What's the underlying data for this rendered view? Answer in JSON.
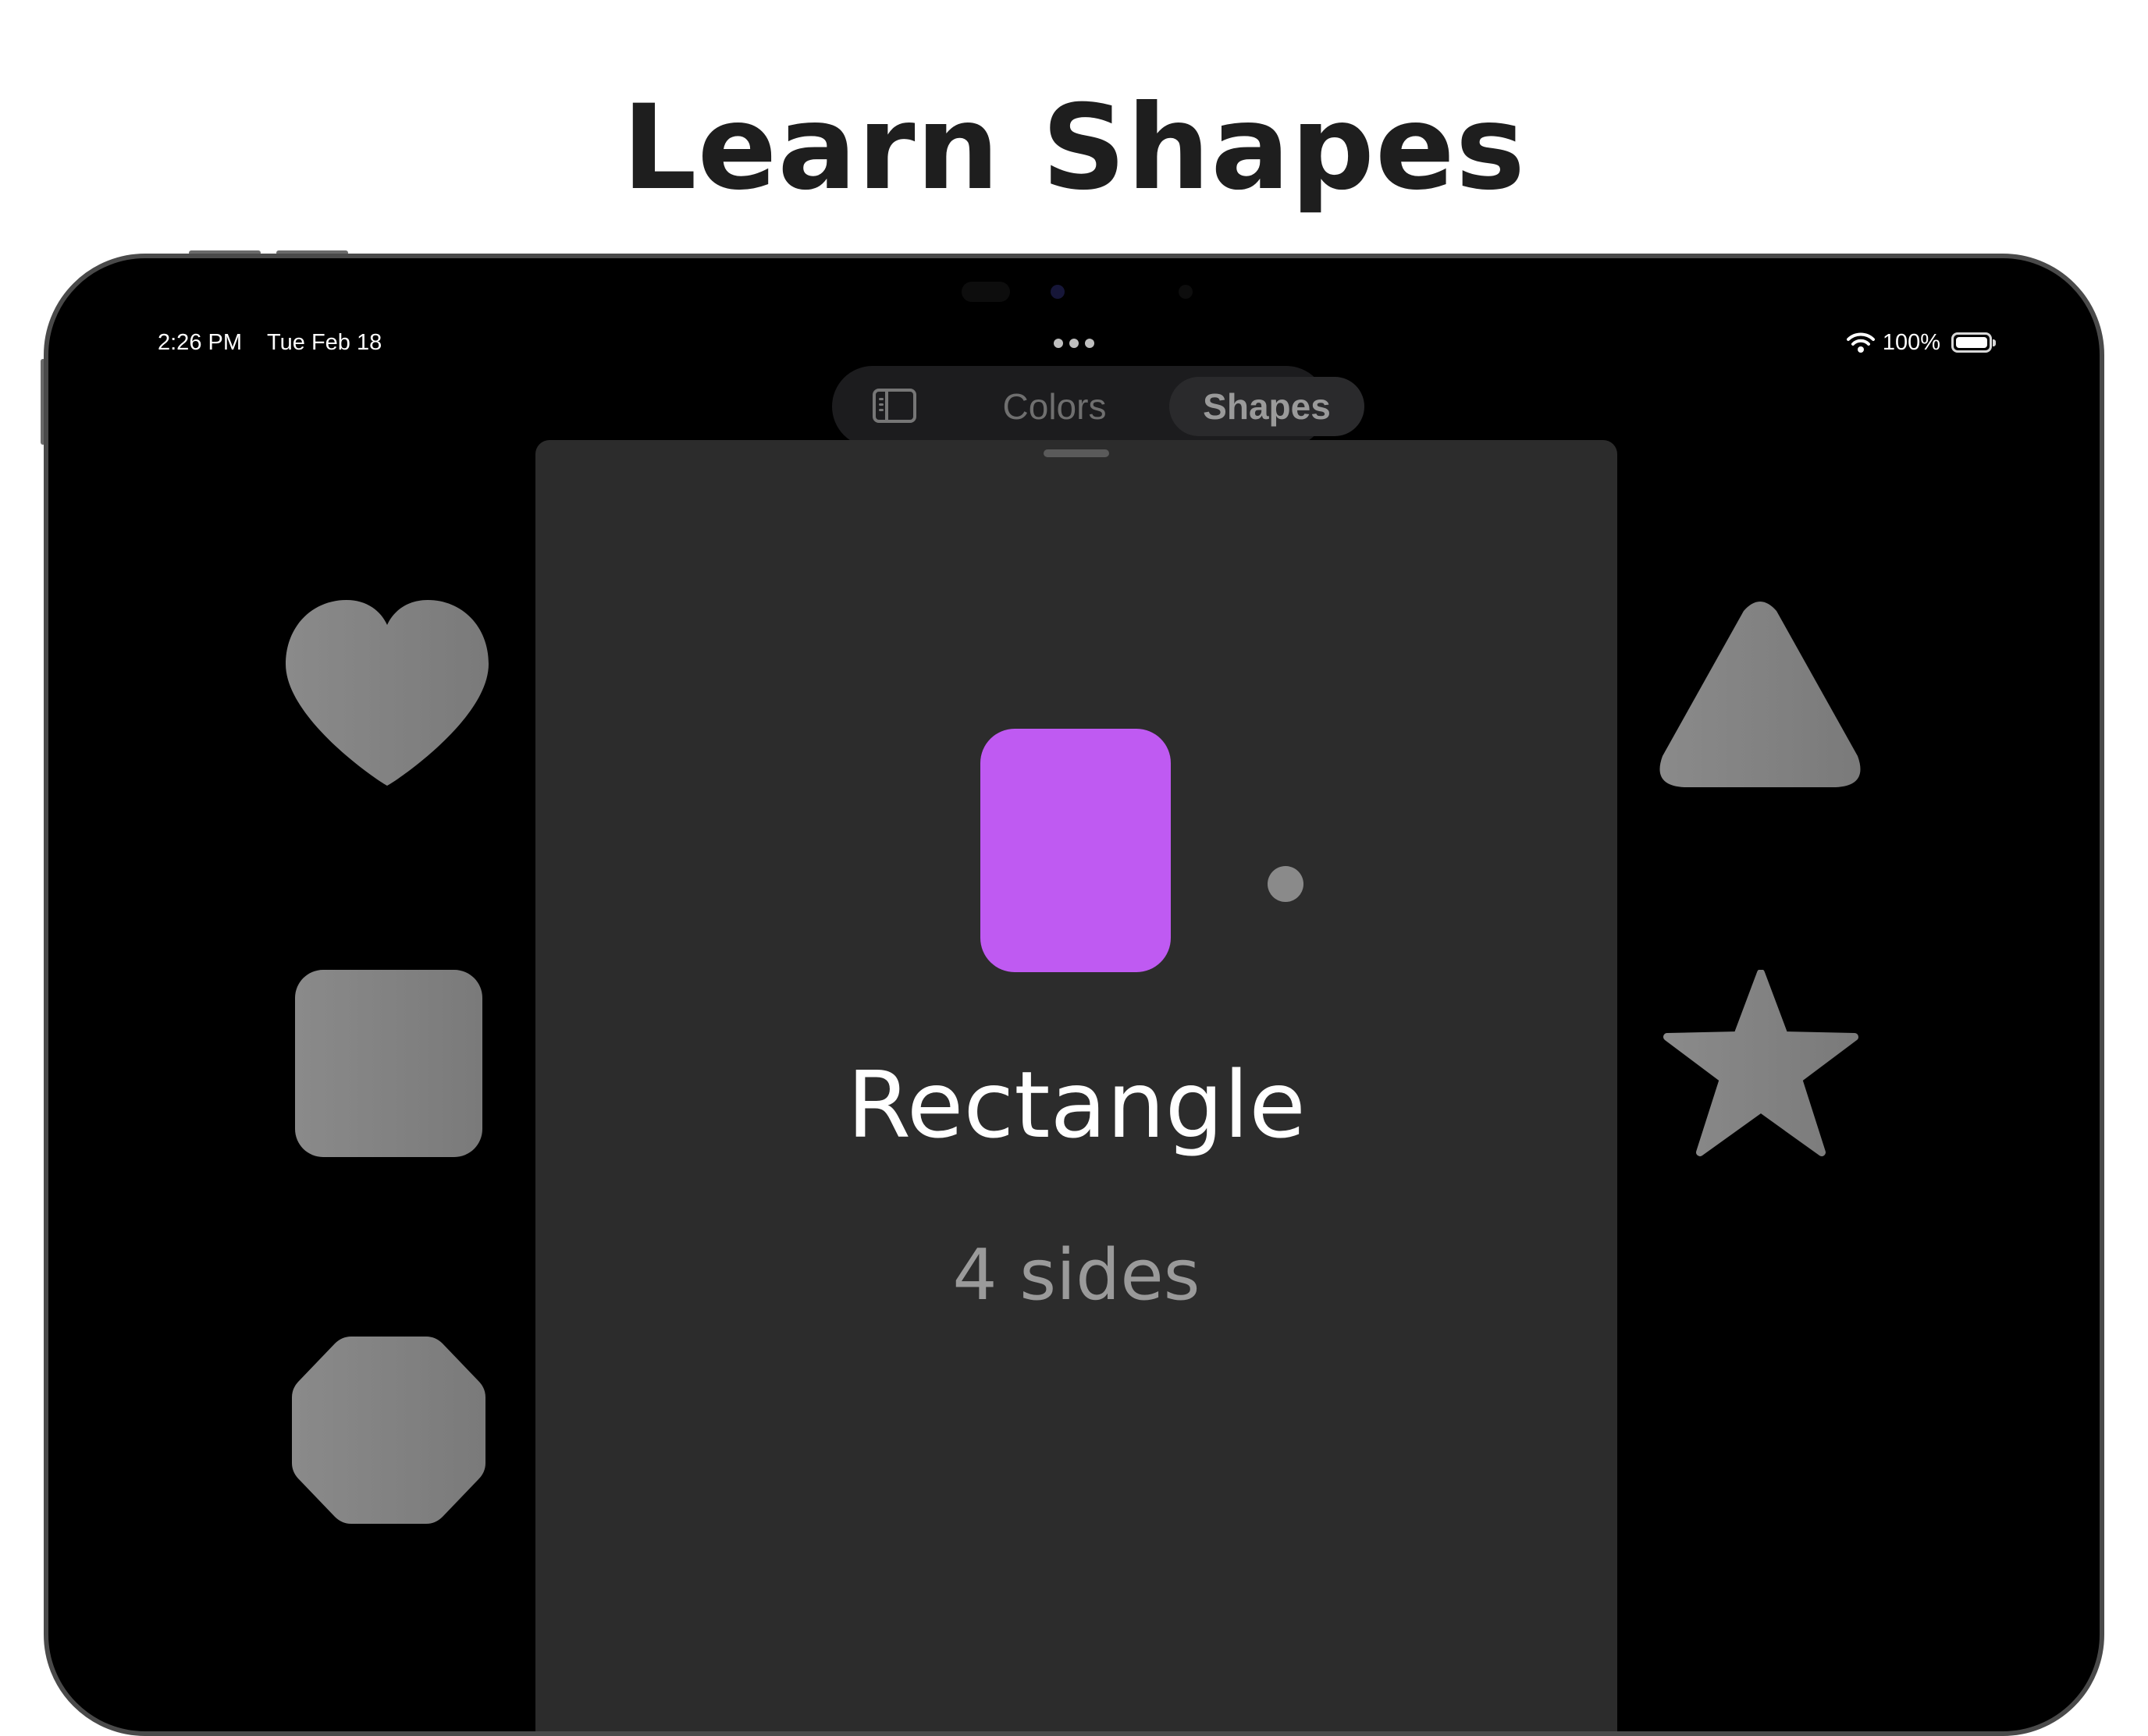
{
  "headline": "Learn Shapes",
  "status_bar": {
    "time": "2:26 PM",
    "date": "Tue Feb 18",
    "battery": "100%",
    "wifi_icon": "wifi-icon",
    "battery_icon": "battery-icon"
  },
  "tabbar": {
    "sidebar_icon": "sidebar-toggle-icon",
    "tabs": [
      {
        "label": "Colors",
        "selected": false
      },
      {
        "label": "Shapes",
        "selected": true
      }
    ]
  },
  "detail": {
    "shape_name": "Rectangle",
    "sides": "4 sides",
    "shape_color": "#bf5af2"
  },
  "left_shapes": [
    {
      "icon": "heart-icon"
    },
    {
      "icon": "square-icon"
    },
    {
      "icon": "octagon-icon"
    }
  ],
  "right_shapes": [
    {
      "icon": "triangle-icon"
    },
    {
      "icon": "star-icon"
    }
  ],
  "colors": {
    "shape_fill": "#7f7f7f",
    "accent": "#bf5af2"
  }
}
